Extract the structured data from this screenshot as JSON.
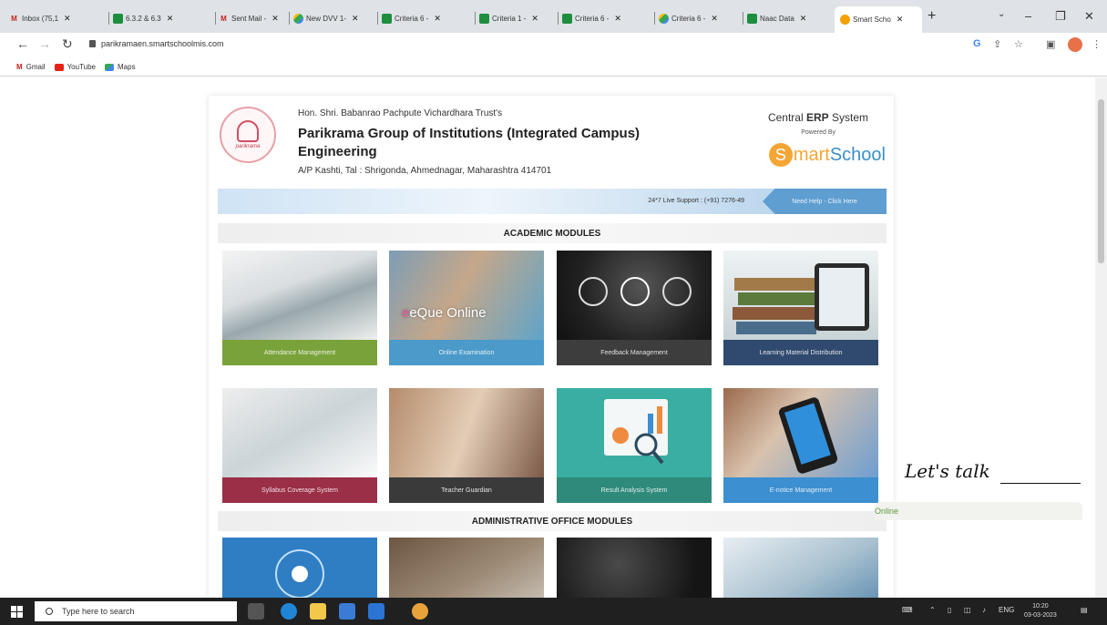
{
  "browser": {
    "tabs": [
      {
        "label": "Inbox (75,1",
        "icon": "gmail-icon"
      },
      {
        "label": "6.3.2 & 6.3",
        "icon": "sheets-icon"
      },
      {
        "label": "Sent Mail -",
        "icon": "gmail-icon"
      },
      {
        "label": "New DVV 1-",
        "icon": "drive-icon"
      },
      {
        "label": "Criteria 6 -",
        "icon": "sheets-icon"
      },
      {
        "label": "Criteria 1 -",
        "icon": "sheets-icon"
      },
      {
        "label": "Criteria 6 -",
        "icon": "sheets-icon"
      },
      {
        "label": "Criteria 6 -",
        "icon": "drive-icon"
      },
      {
        "label": "Naac Data",
        "icon": "sheets-icon"
      },
      {
        "label": "Smart Scho",
        "icon": "smartschool-icon",
        "active": true
      }
    ],
    "url": "parikramaen.smartschoolmis.com",
    "bookmarks": [
      {
        "label": "Gmail",
        "icon": "gmail-icon"
      },
      {
        "label": "YouTube",
        "icon": "youtube-icon"
      },
      {
        "label": "Maps",
        "icon": "maps-icon"
      }
    ]
  },
  "header": {
    "trust": "Hon. Shri. Babanrao Pachpute Vichardhara Trust's",
    "institution_line1": "Parikrama Group of Institutions (Integrated Campus)",
    "institution_line2": "Engineering",
    "address": "A/P Kashti, Tal : Shrigonda, Ahmednagar, Maharashtra 414701",
    "logo_text": "parikrama",
    "erp_prefix": "Central ",
    "erp_bold": "ERP",
    "erp_suffix": " System",
    "powered_by": "Powered By",
    "brand_s": "S",
    "brand_mart": "mart",
    "brand_school": " School"
  },
  "support": {
    "text": "24*7 Live Support : (+91) 7276-49",
    "help_button": "Need Help - Click Here"
  },
  "sections": {
    "academic": "ACADEMIC MODULES",
    "admin": "ADMINISTRATIVE OFFICE MODULES"
  },
  "modules": [
    {
      "label": "Attendance Management",
      "color": "#7aa23b"
    },
    {
      "label": "Online Examination",
      "color": "#4c9ac9",
      "overlay": "eQue Online"
    },
    {
      "label": "Feedback Management",
      "color": "#3d3d3d"
    },
    {
      "label": "Learning Material Distribution",
      "color": "#2f4a6e"
    },
    {
      "label": "Syllabus Coverage System",
      "color": "#9a2f47"
    },
    {
      "label": "Teacher Guardian",
      "color": "#3a3a3a"
    },
    {
      "label": "Result Analysis System",
      "color": "#2f8a7c"
    },
    {
      "label": "E-notice Management",
      "color": "#3c8fd0"
    }
  ],
  "chat": {
    "prompt": "Let's talk",
    "status": "Online"
  },
  "taskbar": {
    "search_placeholder": "Type here to search",
    "lang": "ENG",
    "time": "10:20",
    "date": "03-03-2023"
  }
}
